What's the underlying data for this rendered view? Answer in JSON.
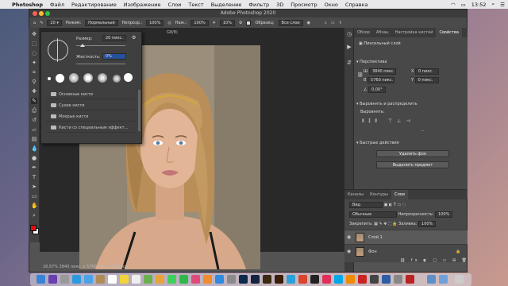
{
  "menubar": {
    "app": "Photoshop",
    "items": [
      "Файл",
      "Редактирование",
      "Изображение",
      "Слои",
      "Текст",
      "Выделение",
      "Фильтр",
      "3D",
      "Просмотр",
      "Окно",
      "Справка"
    ],
    "status": {
      "wifi": "wifi-icon",
      "time": "13:52",
      "battery": "battery-icon"
    }
  },
  "window": {
    "title": "Adobe Photoshop 2020"
  },
  "options": {
    "mode_label": "Режим:",
    "mode_value": "Нормальный",
    "opacity_label": "Непрозр.:",
    "opacity_value": "100%",
    "flow_label": "Наж.:",
    "flow_value": "100%",
    "smoothing_value": "10%",
    "sample_label": "Образец:",
    "sample_value": "Все слои",
    "checkbox_label": "Выбор. для всех слоев"
  },
  "brush_panel": {
    "size_label": "Размер:",
    "size_value": "20 пикс.",
    "hardness_label": "Жесткость:",
    "hardness_value": "0%",
    "folders": [
      "Основные кисти",
      "Сухие кисти",
      "Мокрые кисти",
      "Кисти со специальным эффект..."
    ]
  },
  "canvas": {
    "doc_tab": "G8/8)",
    "status": "16,67%   3840 пикс. x 5760 пикс. (300 ppi)"
  },
  "properties": {
    "tabs": [
      "Обзор",
      "Абзац",
      "Настройка кистей",
      "Свойства"
    ],
    "active_tab": "Свойства",
    "layer_type": "Пиксельный слой",
    "transform_title": "Перспектива",
    "w_label": "Ш",
    "w_value": "3840 пикс.",
    "h_label": "В",
    "h_value": "5760 пикс.",
    "x_label": "X",
    "x_value": "0 пикс.",
    "y_label": "Y",
    "y_value": "0 пикс.",
    "angle_value": "0,00°",
    "align_title": "Выровнять и распределить",
    "align_sub": "Выровнять:",
    "quick_title": "Быстрые действия",
    "btn_remove_bg": "Удалить фон",
    "btn_select_subject": "Выделить предмет"
  },
  "layers": {
    "tabs": [
      "Каналы",
      "Контуры",
      "Слои"
    ],
    "active_tab": "Слои",
    "filter_label": "Вид",
    "blend_mode": "Обычные",
    "opacity_label": "Непрозрачность:",
    "opacity_value": "100%",
    "lock_label": "Закрепить:",
    "fill_label": "Заливка:",
    "fill_value": "100%",
    "rows": [
      {
        "name": "Слой 1"
      },
      {
        "name": "Фон"
      }
    ]
  },
  "colors": {
    "foreground": "#e01010",
    "background": "#ffffff"
  }
}
